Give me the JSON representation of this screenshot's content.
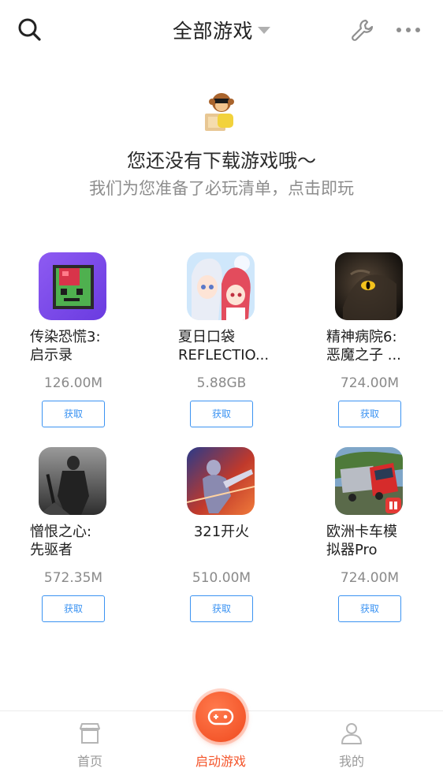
{
  "header": {
    "title": "全部游戏",
    "icons": {
      "search": "search-icon",
      "wrench": "wrench-icon",
      "more": "more-icon",
      "dropdown": "caret-down-icon"
    }
  },
  "empty_state": {
    "mascot": "monkey-mascot-icon",
    "title": "您还没有下载游戏哦～",
    "subtitle": "我们为您准备了必玩清单，点击即玩"
  },
  "games": [
    {
      "name": "传染恐慌3:\n启示录",
      "size": "126.00M",
      "action": "获取",
      "icon": "zombie-pixel-icon"
    },
    {
      "name": "夏日口袋\nREFLECTIO...",
      "size": "5.88GB",
      "action": "获取",
      "icon": "anime-girls-icon"
    },
    {
      "name": "精神病院6:\n恶魔之子 ...",
      "size": "724.00M",
      "action": "获取",
      "icon": "demon-eye-icon"
    },
    {
      "name": "憎恨之心:\n先驱者",
      "size": "572.35M",
      "action": "获取",
      "icon": "dark-knight-icon"
    },
    {
      "name": "321开火",
      "size": "510.00M",
      "action": "获取",
      "icon": "shooter-hero-icon"
    },
    {
      "name": "欧洲卡车模\n拟器Pro",
      "size": "724.00M",
      "action": "获取",
      "icon": "red-truck-icon"
    }
  ],
  "bottom_nav": {
    "items": [
      {
        "label": "首页",
        "icon": "shop-icon"
      },
      {
        "label": "启动游戏",
        "icon": "gamepad-icon"
      },
      {
        "label": "我的",
        "icon": "user-icon"
      }
    ],
    "colors": {
      "active": "#f4552b",
      "inactive": "#9a9a9a"
    }
  },
  "colors": {
    "accent_blue": "#3b93f2",
    "launch_orange": "#f04a1e"
  }
}
